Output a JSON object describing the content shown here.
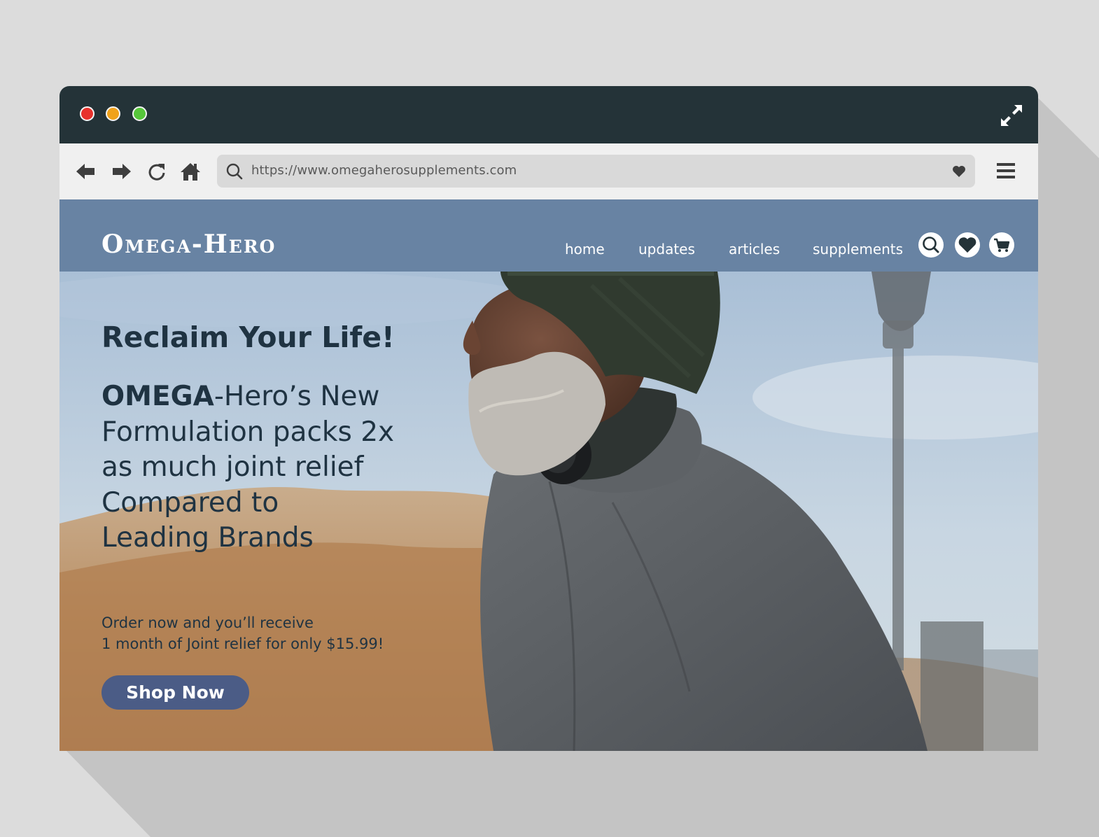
{
  "browser": {
    "url": "https://www.omegaherosupplements.com",
    "window_controls": [
      "close-dot",
      "minimize-dot",
      "maximize-dot"
    ],
    "toolbar_icons": [
      "back-arrow-icon",
      "forward-arrow-icon",
      "reload-icon",
      "home-icon",
      "search-icon",
      "heart-icon",
      "hamburger-menu-icon",
      "expand-icon"
    ]
  },
  "site": {
    "logo": "Omega-Hero",
    "nav": {
      "home": "home",
      "updates": "updates",
      "articles": "articles",
      "supplements": "supplements"
    },
    "nav_icons": [
      "search-icon",
      "heart-icon",
      "cart-icon"
    ],
    "colors": {
      "nav_bg": "#6883a3",
      "titlebar_bg": "#243338",
      "button_bg": "#4b5c86",
      "text_dark": "#1f3342"
    }
  },
  "hero": {
    "headline": "Reclaim Your Life!",
    "copy_brand": "OMEGA",
    "copy_rest_line1": "-Hero’s New",
    "copy_line2": "Formulation packs 2x",
    "copy_line3": "as much joint relief",
    "copy_line4": "Compared to",
    "copy_line5": "Leading Brands",
    "offer_line1": "Order now and you’ll receive",
    "offer_line2": "1 month of Joint relief for only $15.99!",
    "cta": "Shop Now"
  }
}
